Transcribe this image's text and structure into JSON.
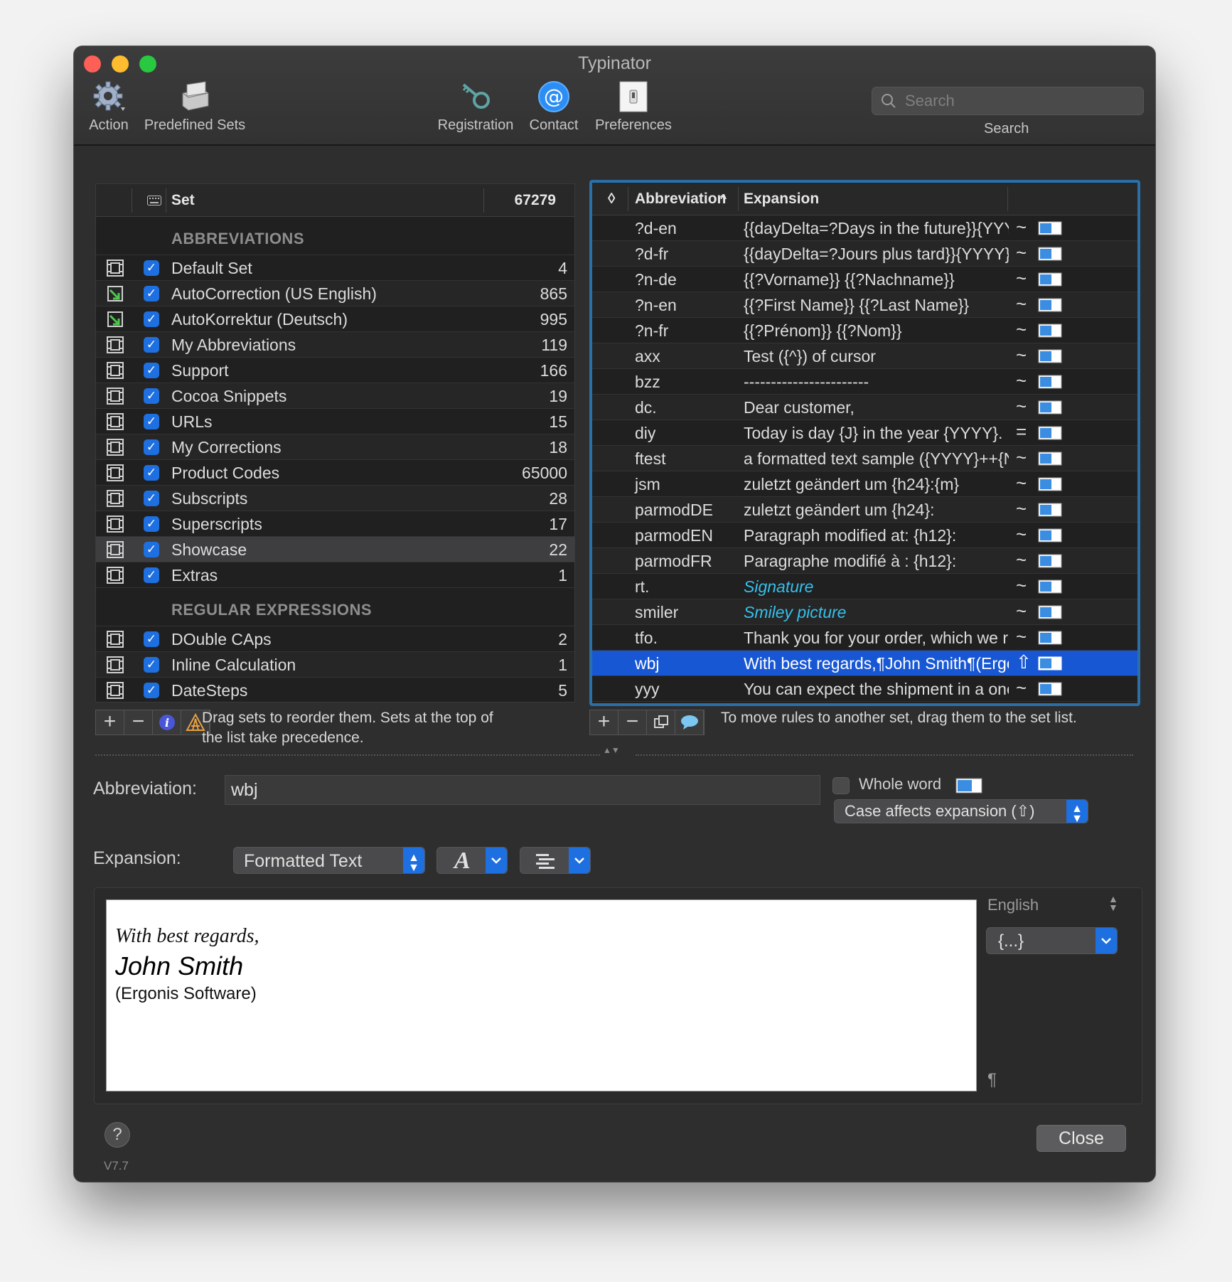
{
  "window": {
    "title": "Typinator"
  },
  "toolbar": {
    "action": "Action",
    "predefined_sets": "Predefined Sets",
    "registration": "Registration",
    "contact": "Contact",
    "preferences": "Preferences",
    "search_placeholder": "Search",
    "search_label": "Search"
  },
  "sets": {
    "header_set": "Set",
    "header_total": "67279",
    "group_abbreviations": "ABBREVIATIONS",
    "group_regex": "REGULAR EXPRESSIONS",
    "abbreviations": [
      {
        "name": "Default Set",
        "count": "4",
        "type": "set"
      },
      {
        "name": "AutoCorrection (US English)",
        "count": "865",
        "type": "auto"
      },
      {
        "name": "AutoKorrektur (Deutsch)",
        "count": "995",
        "type": "auto"
      },
      {
        "name": "My Abbreviations",
        "count": "119",
        "type": "set"
      },
      {
        "name": "Support",
        "count": "166",
        "type": "set"
      },
      {
        "name": "Cocoa Snippets",
        "count": "19",
        "type": "set"
      },
      {
        "name": "URLs",
        "count": "15",
        "type": "set"
      },
      {
        "name": "My Corrections",
        "count": "18",
        "type": "set"
      },
      {
        "name": "Product Codes",
        "count": "65000",
        "type": "set"
      },
      {
        "name": "Subscripts",
        "count": "28",
        "type": "set"
      },
      {
        "name": "Superscripts",
        "count": "17",
        "type": "set"
      },
      {
        "name": "Showcase",
        "count": "22",
        "type": "set"
      },
      {
        "name": "Extras",
        "count": "1",
        "type": "set"
      }
    ],
    "regex": [
      {
        "name": "DOuble CAps",
        "count": "2",
        "type": "set"
      },
      {
        "name": "Inline Calculation",
        "count": "1",
        "type": "set"
      },
      {
        "name": "DateSteps",
        "count": "5",
        "type": "set"
      }
    ],
    "selected": "Showcase",
    "note": "Drag sets to reorder them. Sets at the top of the list take precedence."
  },
  "rules": {
    "header_marker": "◊",
    "header_abbreviation": "Abbreviation",
    "header_expansion": "Expansion",
    "items": [
      {
        "abbr": "?d-en",
        "exp": "{{dayDelta=?Days in the future}}{YYYY",
        "case": "~",
        "fmt": false
      },
      {
        "abbr": "?d-fr",
        "exp": "{{dayDelta=?Jours plus tard}}{YYYY}-",
        "case": "~",
        "fmt": false
      },
      {
        "abbr": "?n-de",
        "exp": "{{?Vorname}} {{?Nachname}}",
        "case": "~",
        "fmt": false
      },
      {
        "abbr": "?n-en",
        "exp": "{{?First Name}} {{?Last Name}}",
        "case": "~",
        "fmt": false
      },
      {
        "abbr": "?n-fr",
        "exp": "{{?Prénom}} {{?Nom}}",
        "case": "~",
        "fmt": false
      },
      {
        "abbr": "axx",
        "exp": "Test ({^}) of cursor",
        "case": "~",
        "fmt": false
      },
      {
        "abbr": "bzz",
        "exp": "-----------------------",
        "case": "~",
        "fmt": false
      },
      {
        "abbr": "dc.",
        "exp": "Dear customer,",
        "case": "~",
        "fmt": false
      },
      {
        "abbr": "diy",
        "exp": "Today is day {J} in the year {YYYY}.",
        "case": "=",
        "fmt": false
      },
      {
        "abbr": "ftest",
        "exp": "a formatted text sample ({YYYY}++{N",
        "case": "~",
        "fmt": false
      },
      {
        "abbr": "jsm",
        "exp": "zuletzt geändert um {h24}:{m}",
        "case": "~",
        "fmt": false
      },
      {
        "abbr": "parmodDE",
        "exp": "zuletzt geändert um {h24}:",
        "case": "~",
        "fmt": false
      },
      {
        "abbr": "parmodEN",
        "exp": "Paragraph modified at: {h12}:",
        "case": "~",
        "fmt": false
      },
      {
        "abbr": "parmodFR",
        "exp": "Paragraphe modifié à : {h12}:",
        "case": "~",
        "fmt": false
      },
      {
        "abbr": "rt.",
        "exp": "Signature",
        "case": "~",
        "fmt": true
      },
      {
        "abbr": "smiler",
        "exp": "Smiley picture",
        "case": "~",
        "fmt": true
      },
      {
        "abbr": "tfo.",
        "exp": "Thank you for your order, which we re",
        "case": "~",
        "fmt": false
      },
      {
        "abbr": "wbj",
        "exp": "With best regards,¶John  Smith¶(Ergo",
        "case": "⇧",
        "fmt": false,
        "selected": true
      },
      {
        "abbr": "yyy",
        "exp": "You can expect the shipment in a one",
        "case": "~",
        "fmt": false
      }
    ],
    "note": "To move rules to another set, drag them to the set list."
  },
  "editor": {
    "abbreviation_label": "Abbreviation:",
    "abbreviation_value": "wbj",
    "whole_word_label": "Whole word",
    "case_option": "Case affects expansion (⇧)",
    "expansion_label": "Expansion:",
    "expansion_type": "Formatted Text",
    "font_glyph": "A",
    "line1": "With best regards,",
    "line2": "John  Smith",
    "line3": "(Ergonis Software)",
    "language": "English",
    "insert_menu": "{...}",
    "pilcrow": "¶"
  },
  "footer": {
    "help": "?",
    "version": "V7.7",
    "close": "Close"
  },
  "colors": {
    "accent": "#1e6fe0",
    "selection": "#1857d4",
    "formatted_text": "#35c0ea"
  }
}
